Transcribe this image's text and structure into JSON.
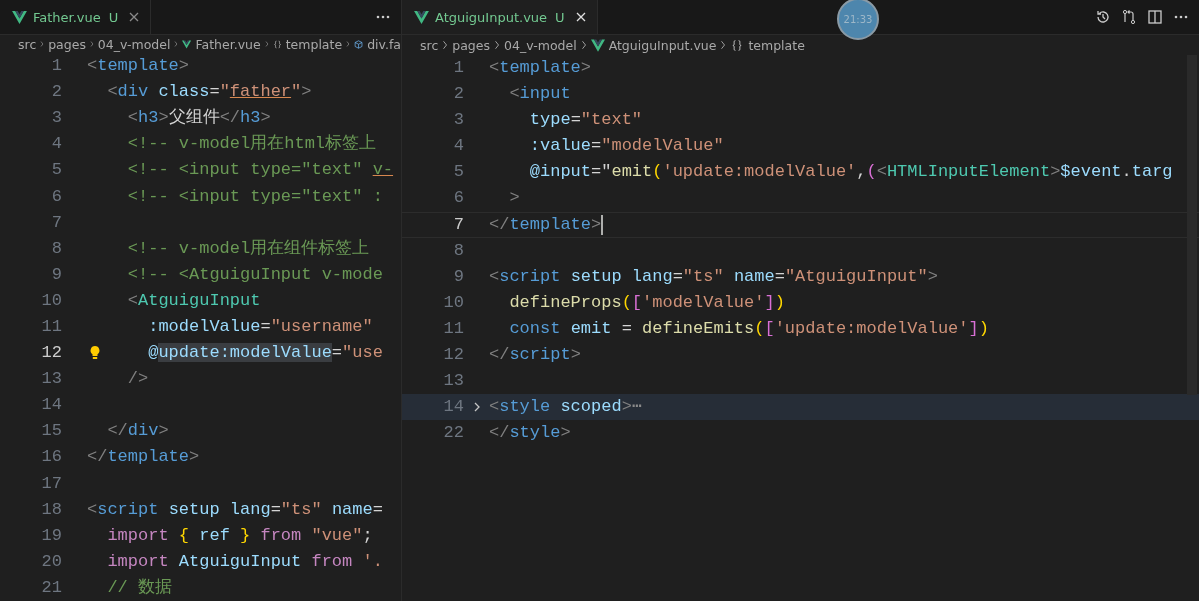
{
  "clock_badge": "21:33",
  "editor_groups": [
    {
      "tab": {
        "label": "Father.vue",
        "status": "U",
        "selected": false
      },
      "breadcrumbs": [
        {
          "kind": "folder",
          "text": "src"
        },
        {
          "kind": "folder",
          "text": "pages"
        },
        {
          "kind": "folder",
          "text": "04_v-model"
        },
        {
          "kind": "file",
          "text": "Father.vue"
        },
        {
          "kind": "braces",
          "text": "template"
        },
        {
          "kind": "element",
          "text": "div.fa"
        }
      ],
      "lines": [
        {
          "number": "1",
          "active": false,
          "tokens": [
            {
              "kind": "p",
              "text": "<"
            },
            {
              "kind": "tag",
              "text": "template"
            },
            {
              "kind": "p",
              "text": ">"
            }
          ]
        },
        {
          "number": "2",
          "active": false,
          "tokens": [
            {
              "kind": "p",
              "text": "  <"
            },
            {
              "kind": "tag",
              "text": "div "
            },
            {
              "kind": "attr",
              "text": "class"
            },
            {
              "kind": "txt",
              "text": "="
            },
            {
              "kind": "str",
              "text": "\""
            },
            {
              "kind": "str",
              "text": "father",
              "underline": true
            },
            {
              "kind": "str",
              "text": "\""
            },
            {
              "kind": "p",
              "text": ">"
            }
          ]
        },
        {
          "number": "3",
          "active": false,
          "tokens": [
            {
              "kind": "p",
              "text": "    <"
            },
            {
              "kind": "tag",
              "text": "h3"
            },
            {
              "kind": "p",
              "text": ">"
            },
            {
              "kind": "txt",
              "text": "父组件"
            },
            {
              "kind": "p",
              "text": "</"
            },
            {
              "kind": "tag",
              "text": "h3"
            },
            {
              "kind": "p",
              "text": ">"
            }
          ]
        },
        {
          "number": "4",
          "active": false,
          "tokens": [
            {
              "kind": "com",
              "text": "    <!-- v-model用在html标签上"
            }
          ]
        },
        {
          "number": "5",
          "active": false,
          "tokens": [
            {
              "kind": "com",
              "text": "    <!-- <input type=\"text\" "
            },
            {
              "kind": "com",
              "text": "v-",
              "underline": true
            }
          ]
        },
        {
          "number": "6",
          "active": false,
          "tokens": [
            {
              "kind": "com",
              "text": "    <!-- <input type=\"text\" :"
            }
          ]
        },
        {
          "number": "7",
          "active": false
        },
        {
          "number": "8",
          "active": false,
          "tokens": [
            {
              "kind": "com",
              "text": "    <!-- v-model用在组件标签上"
            }
          ]
        },
        {
          "number": "9",
          "active": false,
          "tokens": [
            {
              "kind": "com",
              "text": "    <!-- <AtguiguInput v-mode"
            }
          ]
        },
        {
          "number": "10",
          "active": false,
          "tokens": [
            {
              "kind": "p",
              "text": "    <"
            },
            {
              "kind": "comp",
              "text": "AtguiguInput"
            }
          ]
        },
        {
          "number": "11",
          "active": false,
          "tokens": [
            {
              "kind": "attr",
              "text": "      :modelValue"
            },
            {
              "kind": "txt",
              "text": "="
            },
            {
              "kind": "str",
              "text": "\"username\""
            }
          ]
        },
        {
          "number": "12",
          "active": true,
          "lightbulb": true,
          "tokens": [
            {
              "kind": "attr",
              "text": "      @"
            },
            {
              "kind": "attr",
              "text": "update:modelValue",
              "highlight": true
            },
            {
              "kind": "txt",
              "text": "="
            },
            {
              "kind": "str",
              "text": "\"use"
            }
          ]
        },
        {
          "number": "13",
          "active": false,
          "tokens": [
            {
              "kind": "p",
              "text": "    />"
            }
          ]
        },
        {
          "number": "14",
          "active": false
        },
        {
          "number": "15",
          "active": false,
          "tokens": [
            {
              "kind": "p",
              "text": "  </"
            },
            {
              "kind": "tag",
              "text": "div"
            },
            {
              "kind": "p",
              "text": ">"
            }
          ]
        },
        {
          "number": "16",
          "active": false,
          "tokens": [
            {
              "kind": "p",
              "text": "</"
            },
            {
              "kind": "tag",
              "text": "template"
            },
            {
              "kind": "p",
              "text": ">"
            }
          ]
        },
        {
          "number": "17",
          "active": false
        },
        {
          "number": "18",
          "active": false,
          "tokens": [
            {
              "kind": "p",
              "text": "<"
            },
            {
              "kind": "tag",
              "text": "script "
            },
            {
              "kind": "attr",
              "text": "setup lang"
            },
            {
              "kind": "txt",
              "text": "="
            },
            {
              "kind": "str",
              "text": "\"ts\" "
            },
            {
              "kind": "attr",
              "text": "name"
            },
            {
              "kind": "txt",
              "text": "="
            }
          ]
        },
        {
          "number": "19",
          "active": false,
          "tokens": [
            {
              "kind": "kw",
              "text": "  import "
            },
            {
              "kind": "b1",
              "text": "{ "
            },
            {
              "kind": "attr",
              "text": "ref "
            },
            {
              "kind": "b1",
              "text": "} "
            },
            {
              "kind": "kw",
              "text": "from "
            },
            {
              "kind": "str",
              "text": "\"vue\""
            },
            {
              "kind": "txt",
              "text": ";"
            }
          ]
        },
        {
          "number": "20",
          "active": false,
          "tokens": [
            {
              "kind": "kw",
              "text": "  import "
            },
            {
              "kind": "attr",
              "text": "AtguiguInput "
            },
            {
              "kind": "kw",
              "text": "from "
            },
            {
              "kind": "str",
              "text": "'."
            }
          ]
        },
        {
          "number": "21",
          "active": false,
          "tokens": [
            {
              "kind": "com",
              "text": "  // 数据"
            }
          ]
        }
      ]
    },
    {
      "tab": {
        "label": "AtguiguInput.vue",
        "status": "U",
        "selected": true
      },
      "breadcrumbs": [
        {
          "kind": "folder",
          "text": "src"
        },
        {
          "kind": "folder",
          "text": "pages"
        },
        {
          "kind": "folder",
          "text": "04_v-model"
        },
        {
          "kind": "file",
          "text": "AtguiguInput.vue"
        },
        {
          "kind": "braces",
          "text": "template"
        }
      ],
      "lines": [
        {
          "number": "1",
          "active": false,
          "tokens": [
            {
              "kind": "p",
              "text": "<"
            },
            {
              "kind": "tag",
              "text": "template"
            },
            {
              "kind": "p",
              "text": ">"
            }
          ]
        },
        {
          "number": "2",
          "active": false,
          "tokens": [
            {
              "kind": "p",
              "text": "  <"
            },
            {
              "kind": "tag",
              "text": "input"
            }
          ]
        },
        {
          "number": "3",
          "active": false,
          "tokens": [
            {
              "kind": "attr",
              "text": "    type"
            },
            {
              "kind": "txt",
              "text": "="
            },
            {
              "kind": "str",
              "text": "\"text\""
            }
          ]
        },
        {
          "number": "4",
          "active": false,
          "tokens": [
            {
              "kind": "attr",
              "text": "    :value"
            },
            {
              "kind": "txt",
              "text": "="
            },
            {
              "kind": "str",
              "text": "\"modelValue\""
            }
          ]
        },
        {
          "number": "5",
          "active": false,
          "tokens": [
            {
              "kind": "attr",
              "text": "    @input"
            },
            {
              "kind": "txt",
              "text": "=\""
            },
            {
              "kind": "fn",
              "text": "emit"
            },
            {
              "kind": "b1",
              "text": "("
            },
            {
              "kind": "str",
              "text": "'update:modelValue'"
            },
            {
              "kind": "txt",
              "text": ","
            },
            {
              "kind": "b2",
              "text": "("
            },
            {
              "kind": "p",
              "text": "<"
            },
            {
              "kind": "comp",
              "text": "HTMLInputElement"
            },
            {
              "kind": "p",
              "text": ">"
            },
            {
              "kind": "attr",
              "text": "$event"
            },
            {
              "kind": "txt",
              "text": "."
            },
            {
              "kind": "attr",
              "text": "targ"
            }
          ]
        },
        {
          "number": "6",
          "active": false,
          "tokens": [
            {
              "kind": "p",
              "text": "  >"
            }
          ]
        },
        {
          "number": "7",
          "active": true,
          "cursor": true,
          "tokens": [
            {
              "kind": "p",
              "text": "</"
            },
            {
              "kind": "tag",
              "text": "template"
            },
            {
              "kind": "p",
              "text": ">"
            }
          ]
        },
        {
          "number": "8",
          "active": false
        },
        {
          "number": "9",
          "active": false,
          "tokens": [
            {
              "kind": "p",
              "text": "<"
            },
            {
              "kind": "tag",
              "text": "script "
            },
            {
              "kind": "attr",
              "text": "setup lang"
            },
            {
              "kind": "txt",
              "text": "="
            },
            {
              "kind": "str",
              "text": "\"ts\" "
            },
            {
              "kind": "attr",
              "text": "name"
            },
            {
              "kind": "txt",
              "text": "="
            },
            {
              "kind": "str",
              "text": "\"AtguiguInput\""
            },
            {
              "kind": "p",
              "text": ">"
            }
          ]
        },
        {
          "number": "10",
          "active": false,
          "tokens": [
            {
              "kind": "fn",
              "text": "  defineProps"
            },
            {
              "kind": "b1",
              "text": "("
            },
            {
              "kind": "b2",
              "text": "["
            },
            {
              "kind": "str",
              "text": "'modelValue'"
            },
            {
              "kind": "b2",
              "text": "]"
            },
            {
              "kind": "b1",
              "text": ")"
            }
          ]
        },
        {
          "number": "11",
          "active": false,
          "tokens": [
            {
              "kind": "tag",
              "text": "  const "
            },
            {
              "kind": "attr",
              "text": "emit "
            },
            {
              "kind": "txt",
              "text": "= "
            },
            {
              "kind": "fn",
              "text": "defineEmits"
            },
            {
              "kind": "b1",
              "text": "("
            },
            {
              "kind": "b2",
              "text": "["
            },
            {
              "kind": "str",
              "text": "'update:modelValue'"
            },
            {
              "kind": "b2",
              "text": "]"
            },
            {
              "kind": "b1",
              "text": ")"
            }
          ]
        },
        {
          "number": "12",
          "active": false,
          "tokens": [
            {
              "kind": "p",
              "text": "</"
            },
            {
              "kind": "tag",
              "text": "script"
            },
            {
              "kind": "p",
              "text": ">"
            }
          ]
        },
        {
          "number": "13",
          "active": false
        },
        {
          "number": "14",
          "active": false,
          "folded": true,
          "tokens": [
            {
              "kind": "p",
              "text": "<"
            },
            {
              "kind": "tag",
              "text": "style "
            },
            {
              "kind": "attr",
              "text": "scoped"
            },
            {
              "kind": "p",
              "text": ">"
            },
            {
              "kind": "ellipsis",
              "text": "⋯"
            }
          ]
        },
        {
          "number": "22",
          "active": false,
          "tokens": [
            {
              "kind": "p",
              "text": "</"
            },
            {
              "kind": "tag",
              "text": "style"
            },
            {
              "kind": "p",
              "text": ">"
            }
          ]
        }
      ]
    }
  ]
}
